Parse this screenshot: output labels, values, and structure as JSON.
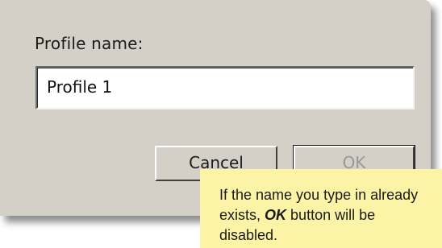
{
  "dialog": {
    "field_label": "Profile name:",
    "input_value": "Profile 1",
    "cancel_label": "Cancel",
    "ok_label": "OK",
    "ok_enabled": false
  },
  "tooltip": {
    "line1_text": "If the name you type in already",
    "line2_prefix": "exists,",
    "line2_bold": "OK",
    "line2_suffix": "button will be disabled."
  },
  "colors": {
    "dialog_bg": "#d4d0c8",
    "tooltip_bg": "#fbf4a6",
    "disabled_text": "#9a9894"
  }
}
